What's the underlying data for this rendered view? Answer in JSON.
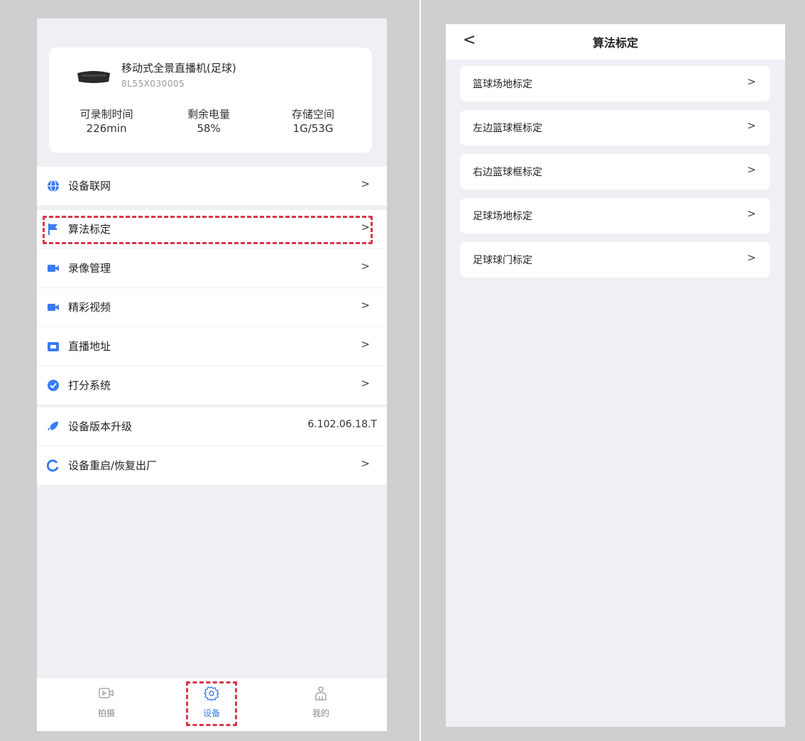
{
  "left": {
    "device": {
      "name": "移动式全景直播机(足球)",
      "serial": "8L55X030005",
      "stats": [
        {
          "label": "可录制时间",
          "value": "226min"
        },
        {
          "label": "剩余电量",
          "value": "58%"
        },
        {
          "label": "存储空间",
          "value": "1G/53G"
        }
      ]
    },
    "menu_group1": [
      {
        "label": "设备联网",
        "icon": "globe-icon",
        "arrow": ">"
      }
    ],
    "menu_group2": [
      {
        "label": "算法标定",
        "icon": "flag-icon",
        "arrow": ">"
      },
      {
        "label": "录像管理",
        "icon": "video-camera-icon",
        "arrow": ">"
      },
      {
        "label": "精彩视频",
        "icon": "video-camera-icon",
        "arrow": ">"
      },
      {
        "label": "直播地址",
        "icon": "tv-icon",
        "arrow": ">"
      },
      {
        "label": "打分系统",
        "icon": "score-icon",
        "arrow": ">"
      }
    ],
    "menu_group3": [
      {
        "label": "设备版本升级",
        "icon": "rocket-icon",
        "value": "6.102.06.18.T"
      },
      {
        "label": "设备重启/恢复出厂",
        "icon": "restart-icon",
        "arrow": ">"
      }
    ],
    "tabs": [
      {
        "label": "拍摄",
        "icon": "camera-tab-icon"
      },
      {
        "label": "设备",
        "icon": "gear-tab-icon"
      },
      {
        "label": "我的",
        "icon": "profile-tab-icon"
      }
    ],
    "colors": {
      "accent": "#3a7bf6",
      "highlight": "#d6364a"
    }
  },
  "right": {
    "back": "<",
    "title": "算法标定",
    "items": [
      {
        "label": "篮球场地标定",
        "arrow": ">"
      },
      {
        "label": "左边篮球框标定",
        "arrow": ">"
      },
      {
        "label": "右边篮球框标定",
        "arrow": ">"
      },
      {
        "label": "足球场地标定",
        "arrow": ">"
      },
      {
        "label": "足球球门标定",
        "arrow": ">"
      }
    ]
  }
}
